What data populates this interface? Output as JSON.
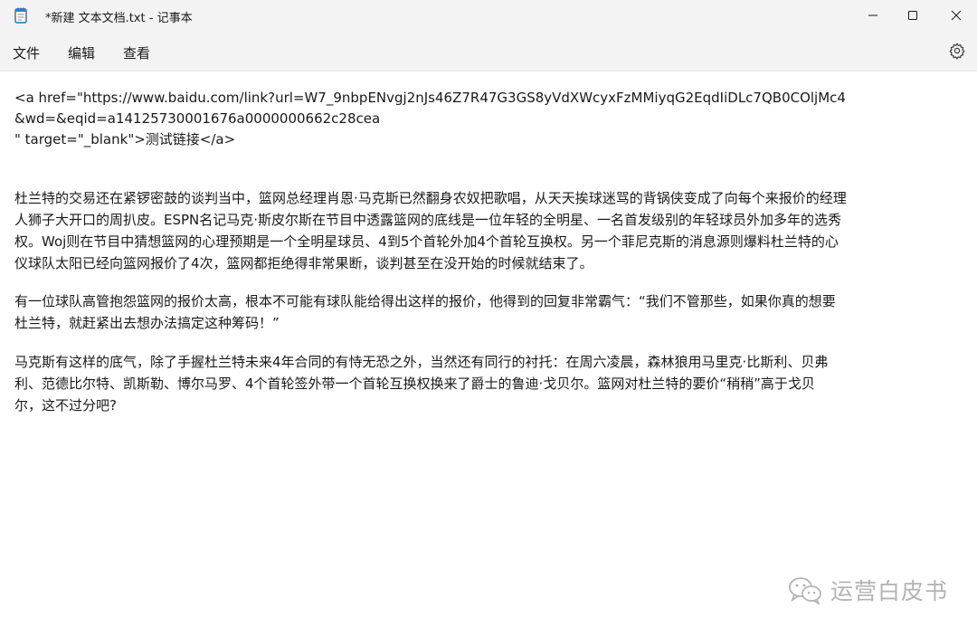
{
  "window": {
    "title": "*新建 文本文档.txt - 记事本"
  },
  "menu": {
    "file": "文件",
    "edit": "编辑",
    "view": "查看"
  },
  "editor": {
    "lines": [
      " <a href=\"https://www.baidu.com/link?url=W7_9nbpENvgj2nJs46Z7R47G3GS8yVdXWcyxFzMMiyqG2EqdIiDLc7QB0COljMc4",
      "&wd=&eqid=a14125730001676a0000000662c28cea",
      "\" target=\"_blank\">测试链接</a>",
      "杜兰特的交易还在紧锣密鼓的谈判当中，篮网总经理肖恩·马克斯已然翻身农奴把歌唱，从天天挨球迷骂的背锅侠变成了向每个来报价的经理",
      "人狮子大开口的周扒皮。ESPN名记马克·斯皮尔斯在节目中透露篮网的底线是一位年轻的全明星、一名首发级别的年轻球员外加多年的选秀",
      "权。Woj则在节目中猜想篮网的心理预期是一个全明星球员、4到5个首轮外加4个首轮互换权。另一个菲尼克斯的消息源则爆料杜兰特的心",
      "仪球队太阳已经向篮网报价了4次，篮网都拒绝得非常果断，谈判甚至在没开始的时候就结束了。",
      "有一位球队高管抱怨篮网的报价太高，根本不可能有球队能给得出这样的报价，他得到的回复非常霸气：“我们不管那些，如果你真的想要",
      "杜兰特，就赶紧出去想办法搞定这种筹码！”",
      "马克斯有这样的底气，除了手握杜兰特未来4年合同的有恃无恐之外，当然还有同行的衬托：在周六凌晨，森林狼用马里克·比斯利、贝弗",
      "利、范德比尔特、凯斯勒、博尔马罗、4个首轮签外带一个首轮互换权换来了爵士的鲁迪·戈贝尔。篮网对杜兰特的要价“稍稍”高于戈贝",
      "尔，这不过分吧?"
    ]
  },
  "watermark": {
    "text": "运营白皮书"
  }
}
